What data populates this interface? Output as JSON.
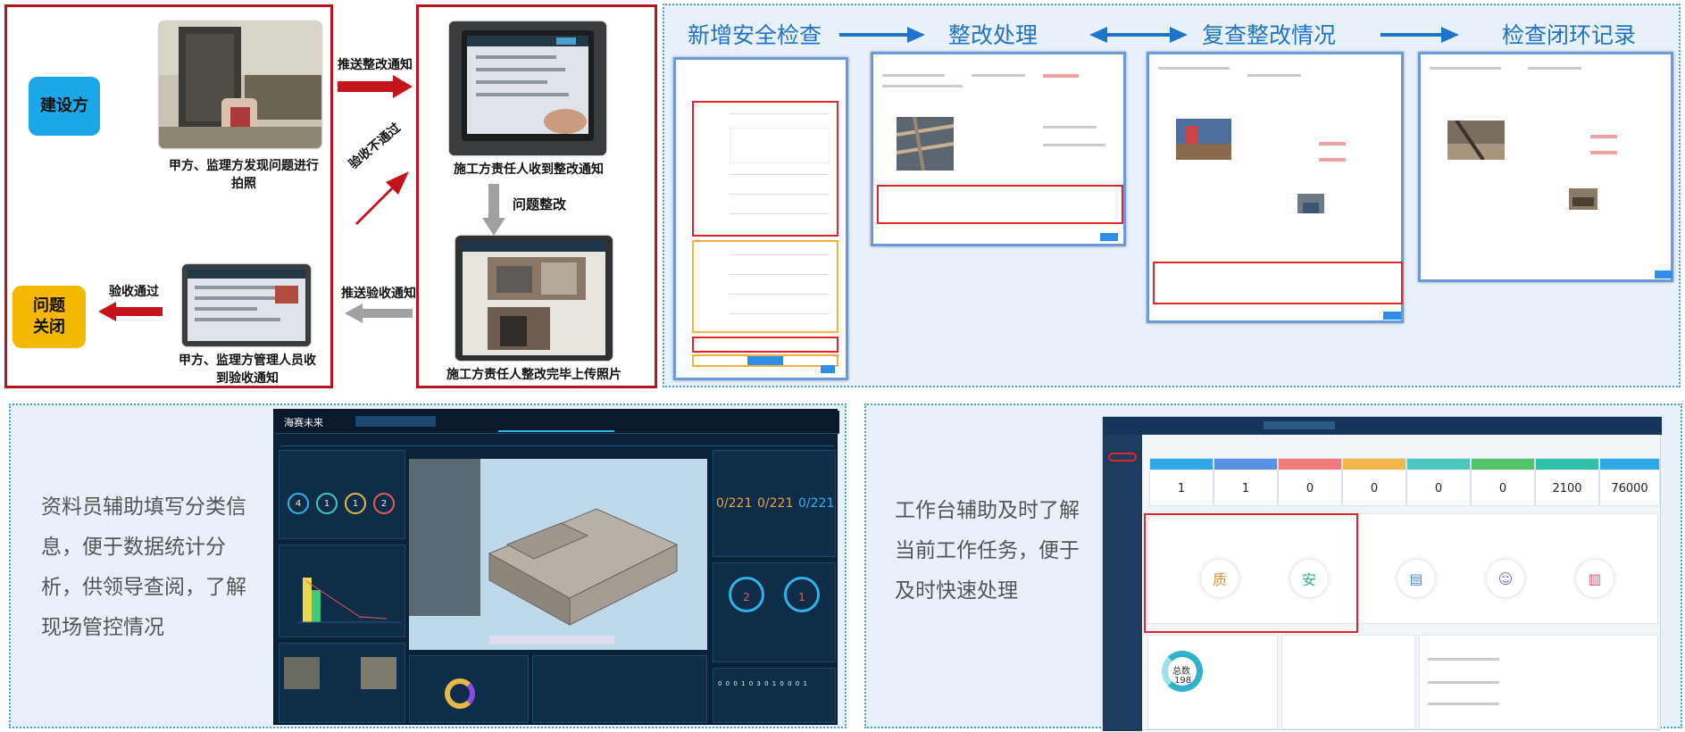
{
  "flow": {
    "builder_label": "建设方",
    "closed_label": "问题\n关闭",
    "caption_find": "甲方、监理方发现问题进行拍照",
    "caption_receive_notice": "施工方责任人收到整改通知",
    "caption_upload": "施工方责任人整改完毕上传照片",
    "caption_accept_notice": "甲方、监理方管理人员收到验收通知",
    "arrow_push_rectify": "推送整改通知",
    "arrow_not_pass": "验收不通过",
    "arrow_rectify": "问题整改",
    "arrow_push_accept": "推送验收通知",
    "arrow_pass": "验收通过"
  },
  "stages": {
    "add_check": "新增安全检查",
    "rectify": "整改处理",
    "recheck": "复查整改情况",
    "closed_record": "检查闭环记录"
  },
  "bottom": {
    "left_text": "资料员辅助填写分类信息，便于数据统计分析，供领导查阅，了解现场管控情况",
    "right_text": "工作台辅助及时了解当前工作任务，便于及时快速处理"
  },
  "dashboard": {
    "logo": "海赛未来",
    "counts_a": "0/221",
    "counts_b": "0/221",
    "counts_c": "0/221",
    "kpi": [
      "4",
      "1",
      "1",
      "2"
    ],
    "ring_a": "2",
    "ring_b": "1",
    "digits_row": "0 0 0 1 0 3 0 1 0 0 0 1"
  },
  "workbench": {
    "stats": [
      "1",
      "1",
      "0",
      "0",
      "0",
      "0",
      "2100",
      "76000"
    ],
    "people_label": "总数",
    "people_count": "198"
  },
  "colors": {
    "red": "#b5141b",
    "blue": "#1f73c8",
    "builder": "#1aa8e8",
    "closed": "#f5b800"
  }
}
